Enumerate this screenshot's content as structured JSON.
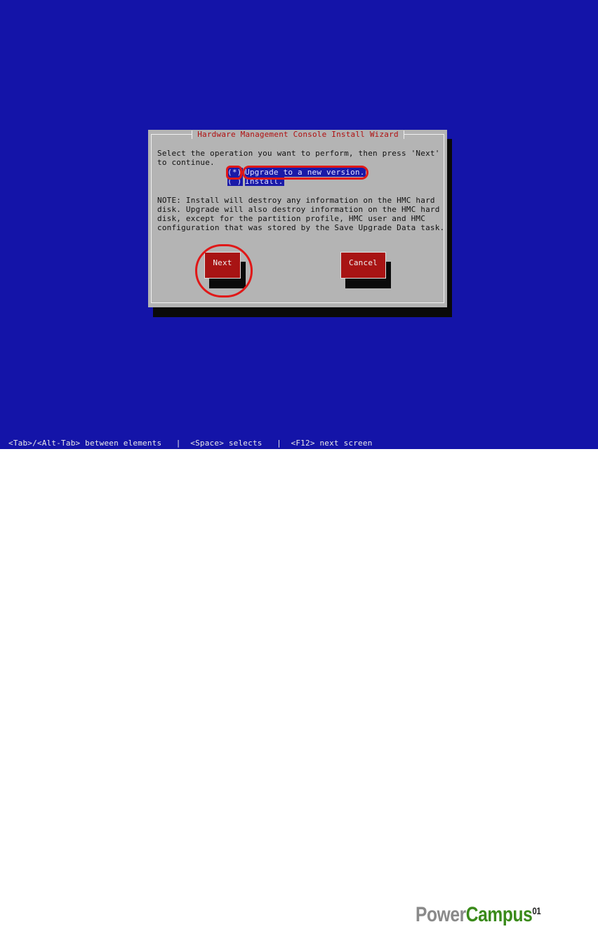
{
  "dialog": {
    "title": "Hardware Management Console Install Wizard",
    "instruction_line1": "Select the operation you want to perform, then press 'Next'",
    "instruction_line2": "to continue.",
    "options": [
      {
        "radio": "(*)",
        "label": "Upgrade to a new version.",
        "selected": true
      },
      {
        "radio": "( )",
        "label": "Install.",
        "selected": false
      }
    ],
    "note_lines": [
      "NOTE: Install will destroy any information on the HMC hard",
      "disk. Upgrade will also destroy information on the HMC hard",
      "disk, except for the partition profile, HMC user and HMC",
      "configuration that was stored by the Save Upgrade Data task."
    ],
    "next_label": "Next",
    "cancel_label": "Cancel"
  },
  "status_bar": "<Tab>/<Alt-Tab> between elements   |  <Space> selects   |  <F12> next screen",
  "watermark": {
    "part1": "Power",
    "part2": "Campus",
    "superscript": "01"
  },
  "colors": {
    "background": "#1414a8",
    "dialog": "#b4b4b4",
    "title_text": "#b01010",
    "button": "#a81414",
    "annotation": "#e01818",
    "logo_gray": "#8a8a8a",
    "logo_green": "#3a8a1a"
  }
}
